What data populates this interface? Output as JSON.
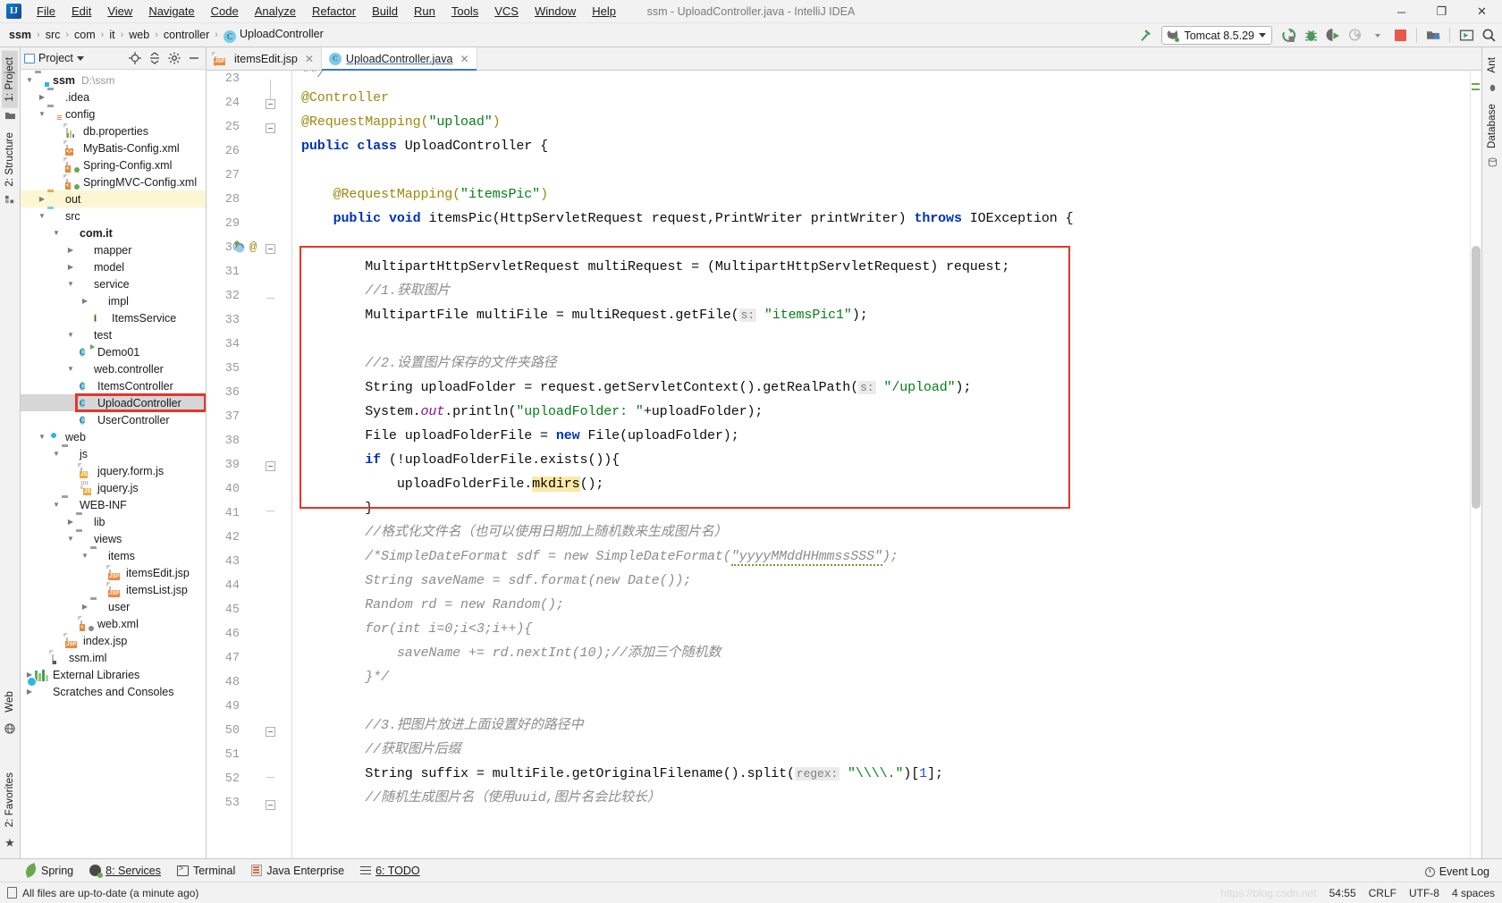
{
  "window": {
    "title": "ssm - UploadController.java - IntelliJ IDEA",
    "logo": "IJ",
    "minimize": "─",
    "maximize": "❐",
    "close": "✕"
  },
  "menubar": [
    {
      "label": "File"
    },
    {
      "label": "Edit"
    },
    {
      "label": "View"
    },
    {
      "label": "Navigate"
    },
    {
      "label": "Code"
    },
    {
      "label": "Analyze"
    },
    {
      "label": "Refactor"
    },
    {
      "label": "Build"
    },
    {
      "label": "Run"
    },
    {
      "label": "Tools"
    },
    {
      "label": "VCS"
    },
    {
      "label": "Window"
    },
    {
      "label": "Help"
    }
  ],
  "breadcrumb": {
    "items": [
      "ssm",
      "src",
      "com",
      "it",
      "web",
      "controller"
    ],
    "leaf": "UploadController",
    "leaf_badge": "C",
    "separator": "›"
  },
  "toolbar": {
    "build_icon": "hammer-icon",
    "run_config": "Tomcat 8.5.29",
    "run_icon": "run-icon",
    "debug_icon": "debug-icon",
    "run_coverage_icon": "run-with-coverage-icon",
    "profile_icon": "profile-icon",
    "stop_icon": "stop-icon",
    "project_structure_icon": "project-structure-icon",
    "run_anything_icon": "run-anything-icon",
    "search_icon": "search-everywhere-icon"
  },
  "left_strip": {
    "project_tab": "1: Project",
    "structure_tab": "2: Structure",
    "favorites_tab": "2: Favorites",
    "web_tab": "Web"
  },
  "right_strip": {
    "ant_tab": "Ant",
    "database_tab": "Database"
  },
  "project_pane": {
    "title": "Project",
    "locate_icon": "locate-icon",
    "collapse_icon": "collapse-all-icon",
    "settings_icon": "gear-icon",
    "hide_icon": "hide-icon",
    "tree": [
      {
        "label": "ssm",
        "path": "D:\\ssm",
        "depth": 0,
        "arrow": "down",
        "icon": "module-folder",
        "bold": true
      },
      {
        "label": ".idea",
        "depth": 1,
        "arrow": "right",
        "icon": "folder-grey"
      },
      {
        "label": "config",
        "depth": 1,
        "arrow": "down",
        "icon": "folder-grey-res"
      },
      {
        "label": "db.properties",
        "depth": 2,
        "arrow": "none",
        "icon": "properties-file"
      },
      {
        "label": "MyBatis-Config.xml",
        "depth": 2,
        "arrow": "none",
        "icon": "xml-file"
      },
      {
        "label": "Spring-Config.xml",
        "depth": 2,
        "arrow": "none",
        "icon": "spring-xml-file"
      },
      {
        "label": "SpringMVC-Config.xml",
        "depth": 2,
        "arrow": "none",
        "icon": "spring-xml-file"
      },
      {
        "label": "out",
        "depth": 1,
        "arrow": "right",
        "icon": "folder-orange",
        "highlight": true
      },
      {
        "label": "src",
        "depth": 1,
        "arrow": "down",
        "icon": "folder-blue"
      },
      {
        "label": "com.it",
        "depth": 2,
        "arrow": "down",
        "icon": "package"
      },
      {
        "label": "mapper",
        "depth": 3,
        "arrow": "right",
        "icon": "package"
      },
      {
        "label": "model",
        "depth": 3,
        "arrow": "right",
        "icon": "package"
      },
      {
        "label": "service",
        "depth": 3,
        "arrow": "down",
        "icon": "package"
      },
      {
        "label": "impl",
        "depth": 4,
        "arrow": "right",
        "icon": "package"
      },
      {
        "label": "ItemsService",
        "depth": 4,
        "arrow": "none",
        "icon": "interface"
      },
      {
        "label": "test",
        "depth": 3,
        "arrow": "down",
        "icon": "package"
      },
      {
        "label": "Demo01",
        "depth": 4,
        "arrow": "none",
        "icon": "class-runnable"
      },
      {
        "label": "web.controller",
        "depth": 3,
        "arrow": "down",
        "icon": "package"
      },
      {
        "label": "ItemsController",
        "depth": 4,
        "arrow": "none",
        "icon": "class"
      },
      {
        "label": "UploadController",
        "depth": 4,
        "arrow": "none",
        "icon": "class",
        "selected": true,
        "marked": true
      },
      {
        "label": "UserController",
        "depth": 4,
        "arrow": "none",
        "icon": "class"
      },
      {
        "label": "web",
        "depth": 1,
        "arrow": "down",
        "icon": "web-module"
      },
      {
        "label": "js",
        "depth": 2,
        "arrow": "down",
        "icon": "folder-grey"
      },
      {
        "label": "jquery.form.js",
        "depth": 3,
        "arrow": "none",
        "icon": "js-file"
      },
      {
        "label": "jquery.js",
        "depth": 3,
        "arrow": "none",
        "icon": "js-min-file"
      },
      {
        "label": "WEB-INF",
        "depth": 2,
        "arrow": "down",
        "icon": "folder-grey"
      },
      {
        "label": "lib",
        "depth": 3,
        "arrow": "right",
        "icon": "folder-grey"
      },
      {
        "label": "views",
        "depth": 3,
        "arrow": "down",
        "icon": "folder-grey"
      },
      {
        "label": "items",
        "depth": 4,
        "arrow": "down",
        "icon": "folder-grey"
      },
      {
        "label": "itemsEdit.jsp",
        "depth": 5,
        "arrow": "none",
        "icon": "jsp-file"
      },
      {
        "label": "itemsList.jsp",
        "depth": 5,
        "arrow": "none",
        "icon": "jsp-file"
      },
      {
        "label": "user",
        "depth": 4,
        "arrow": "right",
        "icon": "folder-grey"
      },
      {
        "label": "web.xml",
        "depth": 3,
        "arrow": "none",
        "icon": "web-xml-file"
      },
      {
        "label": "index.jsp",
        "depth": 2,
        "arrow": "none",
        "icon": "jsp-file"
      },
      {
        "label": "ssm.iml",
        "depth": 2,
        "arrow": "none",
        "icon": "iml-file"
      },
      {
        "label": "External Libraries",
        "depth": 0,
        "arrow": "right",
        "icon": "libraries"
      },
      {
        "label": "Scratches and Consoles",
        "depth": 0,
        "arrow": "right",
        "icon": "scratches"
      }
    ]
  },
  "editor": {
    "tabs": [
      {
        "label": "itemsEdit.jsp",
        "icon": "jsp-file",
        "active": false,
        "close": "✕"
      },
      {
        "label": "UploadController.java",
        "icon": "class",
        "active": true,
        "close": "✕"
      }
    ],
    "first_line_number": 23,
    "lines": [
      {
        "n": 23,
        "text": "**/",
        "partial": true
      },
      {
        "n": 24,
        "text": "@Controller"
      },
      {
        "n": 25,
        "text": "@RequestMapping(\"upload\")"
      },
      {
        "n": 26,
        "text": "public class UploadController {"
      },
      {
        "n": 27,
        "text": ""
      },
      {
        "n": 28,
        "text": "    @RequestMapping(\"itemsPic\")"
      },
      {
        "n": 29,
        "text": "    public void itemsPic(HttpServletRequest request,PrintWriter printWriter) throws IOException {"
      },
      {
        "n": 30,
        "text": ""
      },
      {
        "n": 31,
        "text": "        MultipartHttpServletRequest multiRequest = (MultipartHttpServletRequest) request;"
      },
      {
        "n": 32,
        "text": "        //1.获取图片"
      },
      {
        "n": 33,
        "text": "        MultipartFile multiFile = multiRequest.getFile( s: \"itemsPic1\");"
      },
      {
        "n": 34,
        "text": ""
      },
      {
        "n": 35,
        "text": "        //2.设置图片保存的文件夹路径"
      },
      {
        "n": 36,
        "text": "        String uploadFolder = request.getServletContext().getRealPath( s: \"/upload\");"
      },
      {
        "n": 37,
        "text": "        System.out.println(\"uploadFolder: \"+uploadFolder);"
      },
      {
        "n": 38,
        "text": "        File uploadFolderFile = new File(uploadFolder);"
      },
      {
        "n": 39,
        "text": "        if (!uploadFolderFile.exists()){"
      },
      {
        "n": 40,
        "text": "            uploadFolderFile.mkdirs();"
      },
      {
        "n": 41,
        "text": "        }"
      },
      {
        "n": 42,
        "text": "        //格式化文件名（也可以使用日期加上随机数来生成图片名）"
      },
      {
        "n": 43,
        "text": "        /*SimpleDateFormat sdf = new SimpleDateFormat(\"yyyyMMddHHmmssSSS\");"
      },
      {
        "n": 44,
        "text": "        String saveName = sdf.format(new Date());"
      },
      {
        "n": 45,
        "text": "        Random rd = new Random();"
      },
      {
        "n": 46,
        "text": "        for(int i=0;i<3;i++){"
      },
      {
        "n": 47,
        "text": "            saveName += rd.nextInt(10);//添加三个随机数"
      },
      {
        "n": 48,
        "text": "        }*/"
      },
      {
        "n": 49,
        "text": ""
      },
      {
        "n": 50,
        "text": "        //3.把图片放进上面设置好的路径中"
      },
      {
        "n": 51,
        "text": "        //获取图片后缀"
      },
      {
        "n": 52,
        "text": "        String suffix = multiFile.getOriginalFilename().split( regex: \"\\\\.\")[1];"
      },
      {
        "n": 53,
        "text": "        //随机生成图片名（使用uuid,图片名会比较长）"
      }
    ],
    "highlighted_token": "mkdirs",
    "parameter_hints": [
      "s:",
      "regex:"
    ],
    "red_annotation_box": "lines 31-41 highlighted with red rectangle"
  },
  "bottom_tabs": [
    {
      "label": "Spring",
      "icon": "spring-leaf-icon"
    },
    {
      "label": "8: Services",
      "icon": "services-icon",
      "mnemonic": "8"
    },
    {
      "label": "Terminal",
      "icon": "terminal-icon"
    },
    {
      "label": "Java Enterprise",
      "icon": "java-enterprise-icon"
    },
    {
      "label": "6: TODO",
      "icon": "todo-icon",
      "mnemonic": "6"
    }
  ],
  "statusbar": {
    "message": "All files are up-to-date (a minute ago)",
    "message_icon": "document-icon",
    "caret_position": "54:55",
    "line_separator": "CRLF",
    "encoding": "UTF-8",
    "indent": "4 spaces",
    "event_log": "Event Log",
    "event_log_icon": "bell-icon"
  }
}
